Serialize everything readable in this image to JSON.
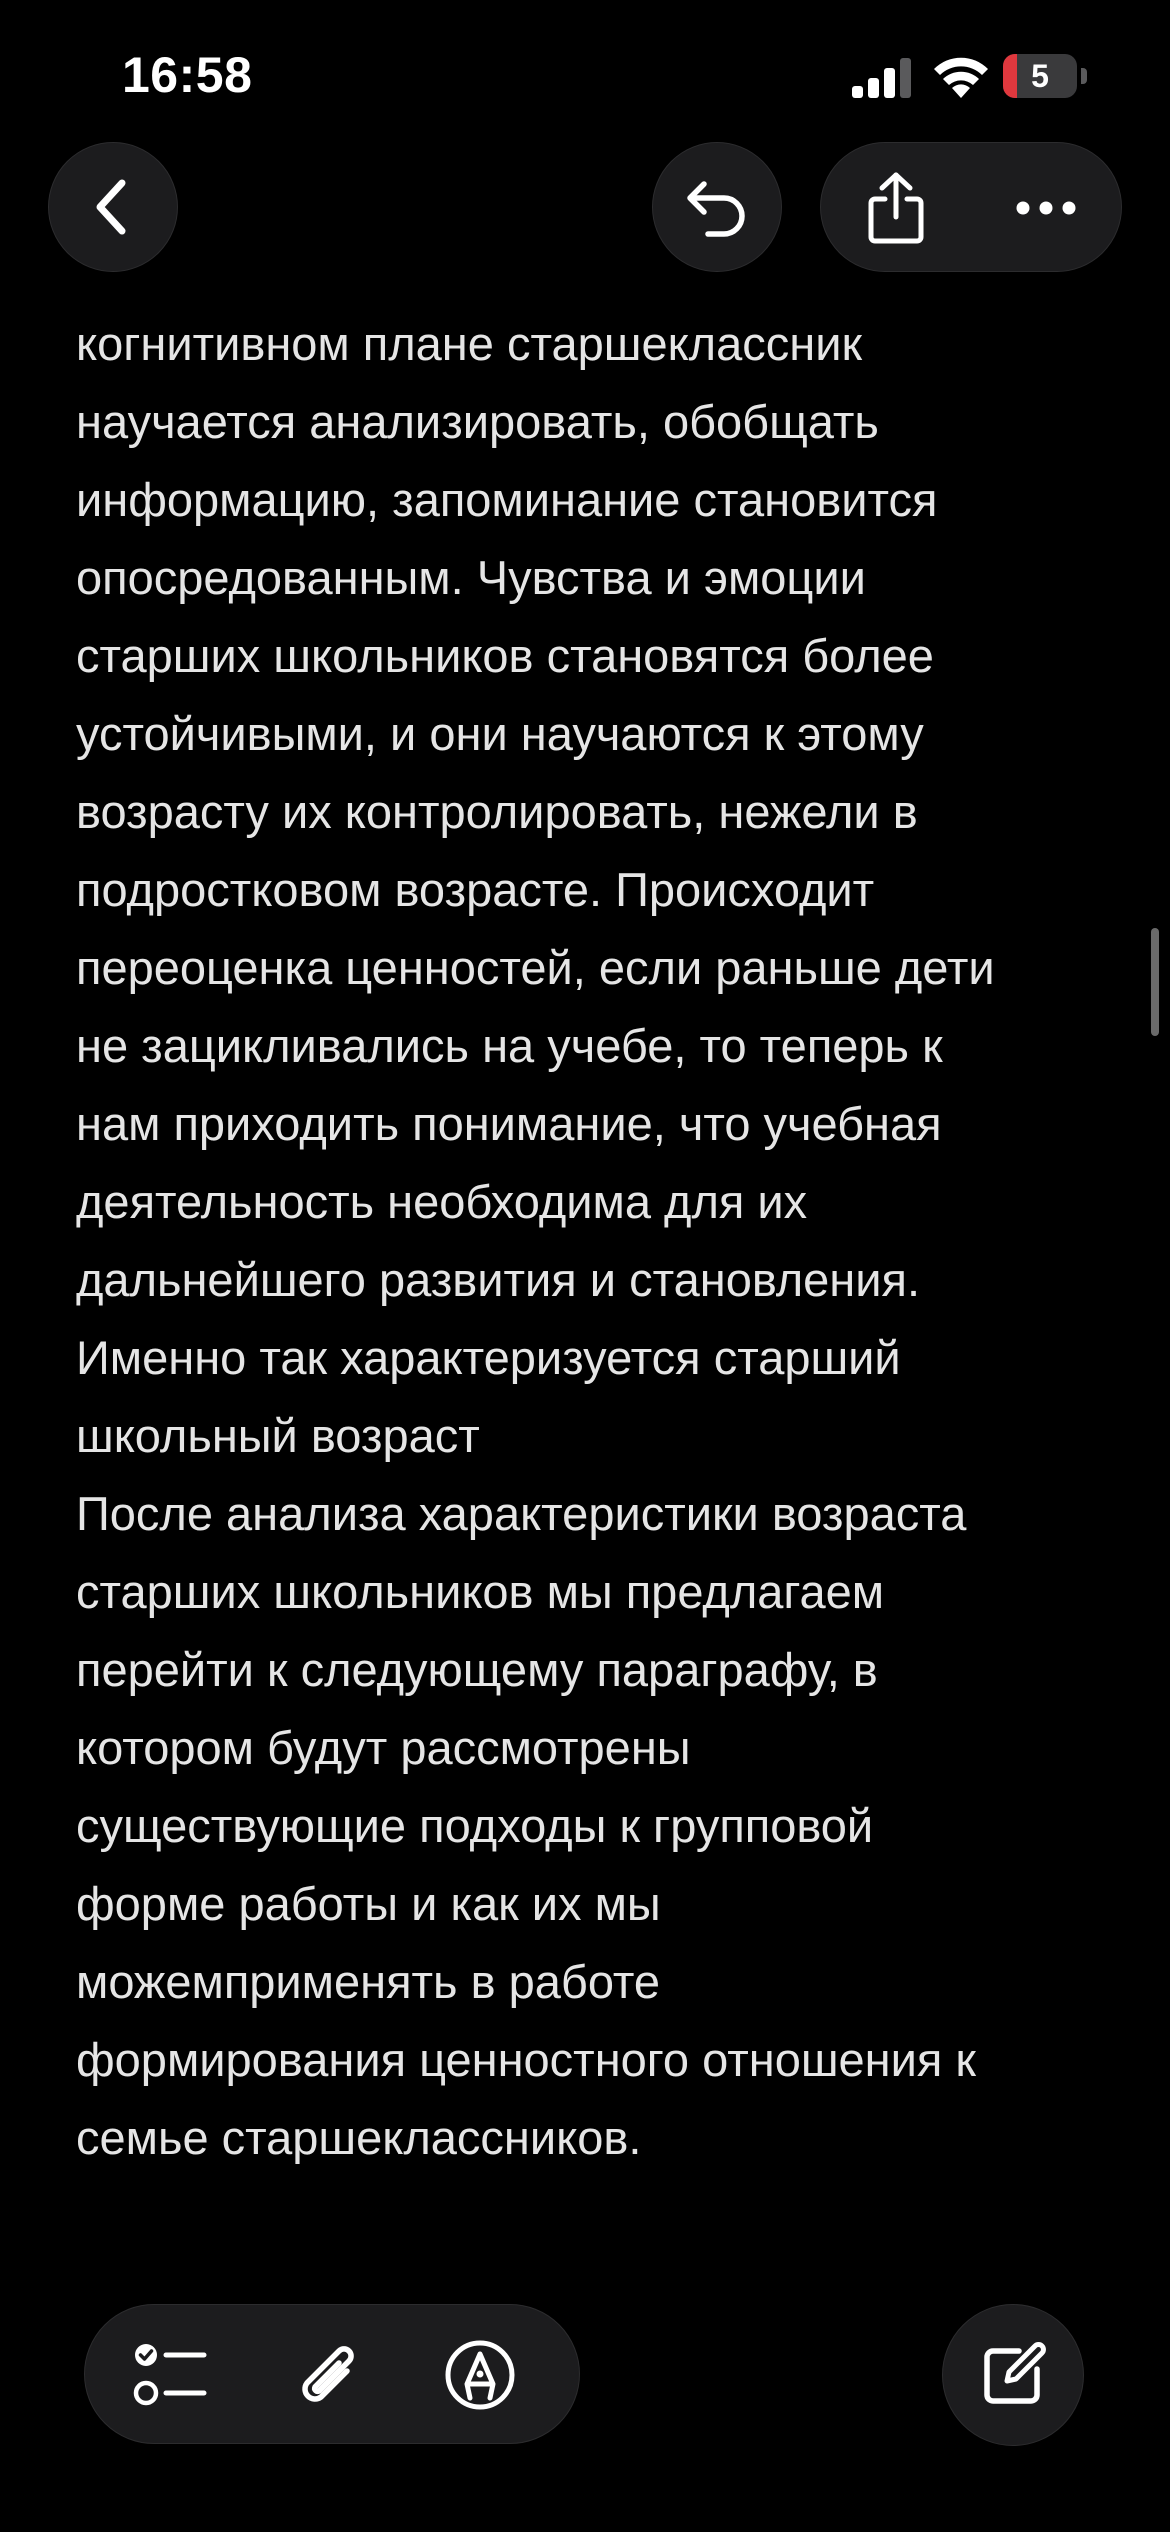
{
  "status_bar": {
    "time": "16:58",
    "battery_level": "5",
    "battery_fraction": 0.05,
    "battery_color": "#e0383e"
  },
  "nav": {
    "back_icon": "chevron-left-icon",
    "undo_icon": "undo-icon",
    "share_icon": "share-icon",
    "more_icon": "ellipsis-icon"
  },
  "note": {
    "lines": [
      "когнитивном плане старшеклассник",
      "научается анализировать, обобщать",
      "информацию, запоминание становится",
      "опосредованным. Чувства и эмоции",
      "старших школьников становятся более",
      "устойчивыми, и они научаются к этому",
      "возрасту их контролировать, нежели в",
      "подростковом возрасте. Происходит",
      "переоценка ценностей, если раньше дети",
      "не зацикливались на учебе, то теперь к",
      "нам приходить понимание, что учебная",
      "деятельность необходима для их",
      "дальнейшего развития и становления.",
      "Именно так характеризуется старший",
      "школьный возраст",
      "После анализа характеристики возраста",
      "старших школьников мы предлагаем",
      "перейти к следующему параграфу, в",
      "котором будут рассмотрены",
      "существующие подходы к групповой",
      "форме работы и как их мы",
      "можемприменять в работе",
      "формирования ценностного отношения к",
      "семье старшеклассников."
    ]
  },
  "toolbar": {
    "checklist_icon": "checklist-icon",
    "attach_icon": "paperclip-icon",
    "markup_icon": "pen-tip-icon",
    "compose_icon": "compose-icon"
  }
}
